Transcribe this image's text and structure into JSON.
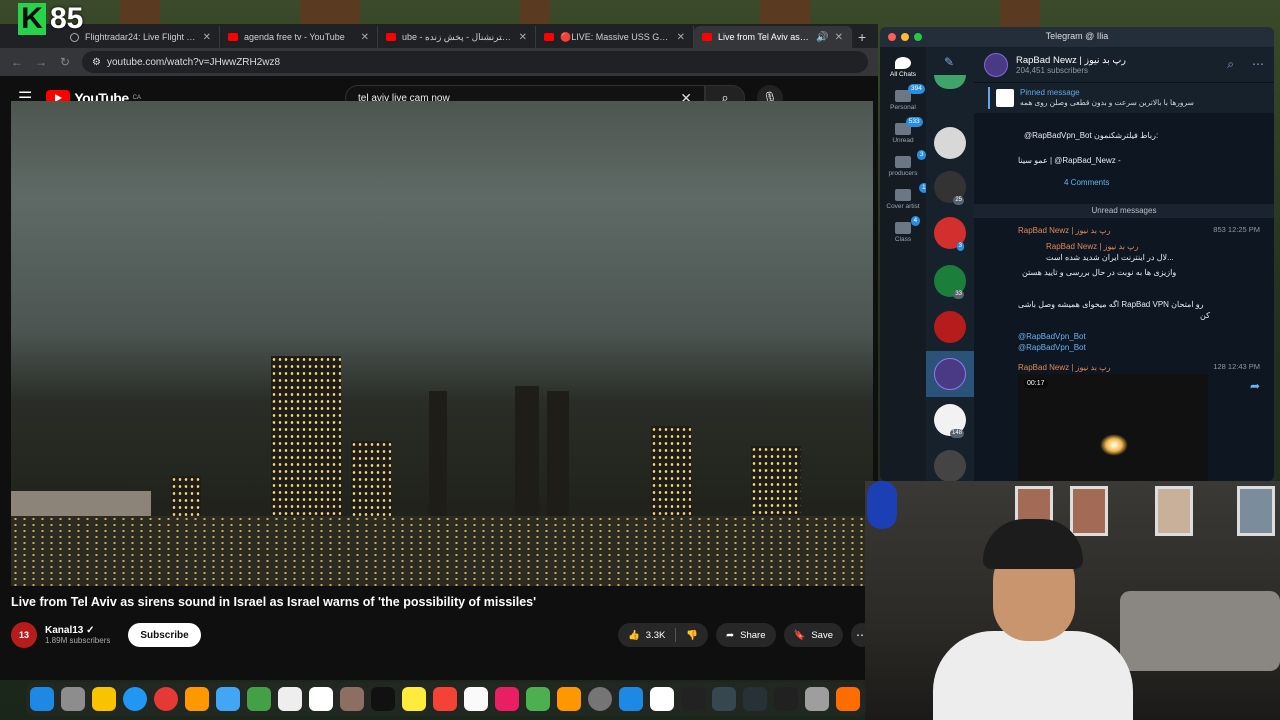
{
  "overlay": {
    "score": "85",
    "logo_letter": "K"
  },
  "browser": {
    "tabs": [
      {
        "label": "Flightradar24: Live Flight Tra",
        "icon": "globe-icon"
      },
      {
        "label": "agenda free tv - YouTube",
        "icon": "youtube-icon"
      },
      {
        "label": "ube - ایران اینترنشنال - پخش زنده",
        "icon": "youtube-icon"
      },
      {
        "label": "🔴LIVE: Massive USS Gerald",
        "icon": "youtube-icon"
      },
      {
        "label": "Live from Tel Aviv as siren",
        "icon": "youtube-icon",
        "active": true
      }
    ],
    "url": "youtube.com/watch?v=JHwwZRH2wz8"
  },
  "youtube": {
    "logo_text": "YouTube",
    "region": "CA",
    "search_value": "tel aviv live cam now",
    "video_title": "Live from Tel Aviv as sirens sound in Israel as Israel warns of 'the possibility of missiles'",
    "channel": {
      "name": "Kanal13",
      "subscribers": "1.89M subscribers",
      "avatar_text": "13"
    },
    "subscribe_label": "Subscribe",
    "likes": "3.3K",
    "share_label": "Share",
    "save_label": "Save"
  },
  "telegram": {
    "window_title": "Telegram @ Ilia",
    "folders": [
      {
        "label": "All Chats",
        "badge": ""
      },
      {
        "label": "Personal",
        "badge": "394"
      },
      {
        "label": "Unread",
        "badge": "533"
      },
      {
        "label": "producers",
        "badge": "3"
      },
      {
        "label": "Cover artist",
        "badge": "1"
      },
      {
        "label": "Class",
        "badge": "4"
      }
    ],
    "chat_badges": [
      "25",
      "3",
      "33",
      "148"
    ],
    "channel_name": "RapBad Newz | رپ بد نیوز",
    "channel_subs": "204,451 subscribers",
    "pinned_label": "Pinned message",
    "pinned_text_1": "سرورها با بالاترین سرعت و بدون قطعی وصلن روی همه",
    "pinned_text_2": "@RapBadVpn_Bot رباط فیلترشکنمون:",
    "pinned_text_3": "عمو سینا | @RapBad_Newz -",
    "comments": "4 Comments",
    "unread_label": "Unread messages",
    "msg1_sender": "RapBad Newz | رپ بد نیوز",
    "msg1_meta": "853 12:25 PM",
    "msg1_quote_sender": "RapBad Newz | رپ بد نیوز",
    "msg1_quote": "لال در اینترنت ایران شدید شده است...",
    "msg1_line1": "وازیزی ها به نوبت در حال بررسی و تایید هستن",
    "msg1_line2": "اگه میخوای همیشه وصل باشی RapBad VPN رو امتحان",
    "msg1_line3": "کن",
    "msg1_link1": "@RapBadVpn_Bot",
    "msg1_link2": "@RapBadVpn_Bot",
    "msg2_sender": "RapBad Newz | رپ بد نیوز",
    "msg2_meta": "128 12:43 PM",
    "video_time": "00:17"
  },
  "colors": {
    "youtube_red": "#ff0000",
    "telegram_bg": "#0e1621",
    "telegram_accent": "#2a8ee0"
  }
}
